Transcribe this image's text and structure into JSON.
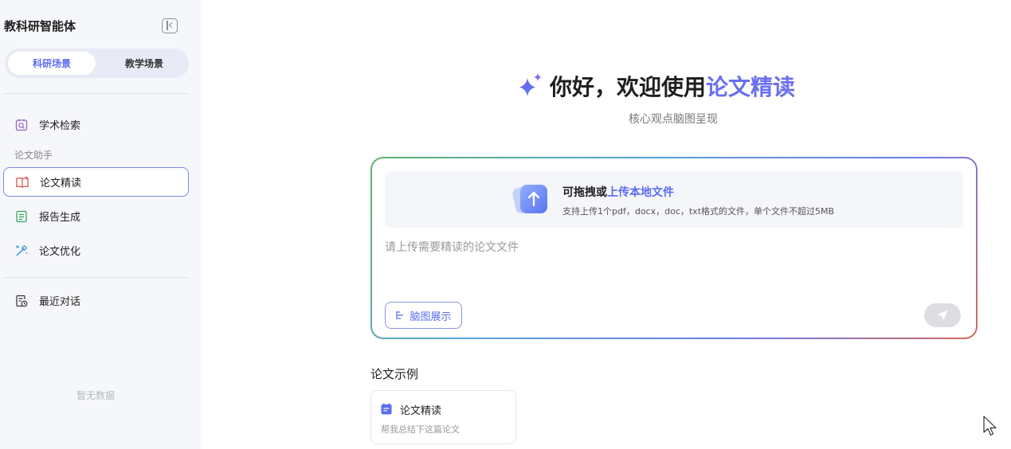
{
  "sidebar": {
    "title": "教科研智能体",
    "segments": {
      "active": "科研场景",
      "inactive": "教学场景"
    },
    "nav": {
      "academic_search": "学术检索",
      "section_label": "论文助手",
      "paper_reading": "论文精读",
      "report_generation": "报告生成",
      "paper_optimization": "论文优化",
      "recent_chats": "最近对话"
    },
    "empty_text": "暂无数据"
  },
  "main": {
    "hero": {
      "greeting": "你好，欢迎使用 ",
      "product": "论文精读",
      "subtitle": "核心观点脑图呈现"
    },
    "upload": {
      "title_prefix": "可拖拽或",
      "title_link": "上传本地文件",
      "description": "支持上传1个pdf，docx，doc，txt格式的文件，单个文件不超过5MB"
    },
    "input_placeholder": "请上传需要精读的论文文件",
    "mindmap_button": "脑图展示",
    "examples": {
      "title": "论文示例",
      "items": [
        {
          "title": "论文精读",
          "desc": "帮我总结下这篇论文"
        }
      ]
    }
  },
  "colors": {
    "accent": "#6b6ff0",
    "link": "#5b6cf0",
    "sidebar_bg": "#f6f7fa"
  }
}
